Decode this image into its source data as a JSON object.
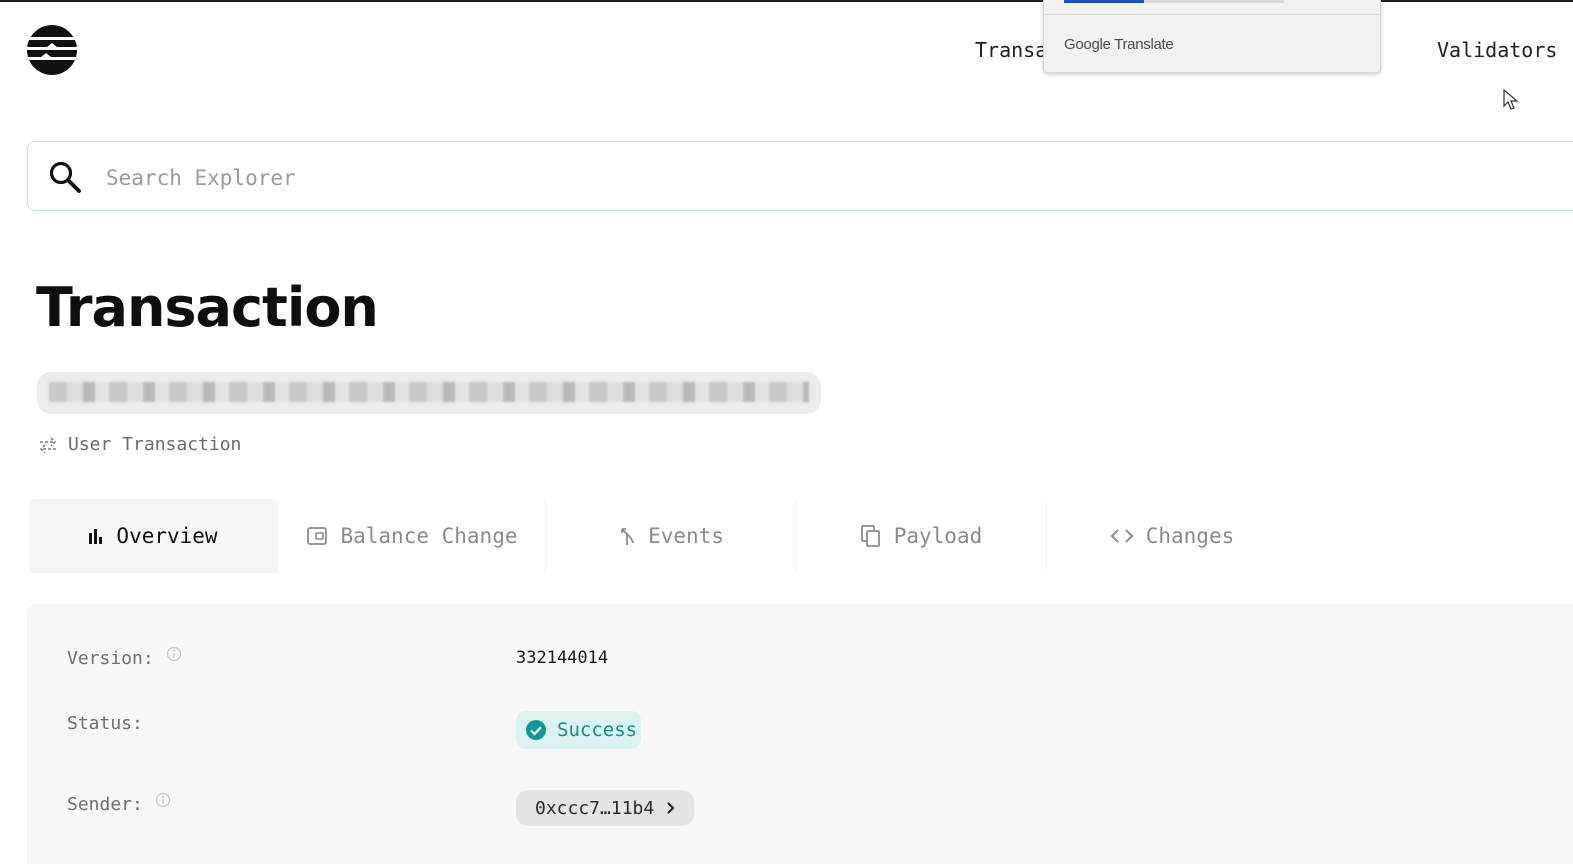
{
  "nav": {
    "transactions_label": "Transa",
    "validators_label": "Validators"
  },
  "translate_popup": {
    "brand": "Google Translate"
  },
  "search": {
    "placeholder": "Search Explorer",
    "value": ""
  },
  "page": {
    "title": "Transaction",
    "hash_blurred": true,
    "tx_type": "User Transaction"
  },
  "tabs": [
    {
      "label": "Overview",
      "icon": "bar-chart-icon",
      "active": true
    },
    {
      "label": "Balance Change",
      "icon": "wallet-icon",
      "active": false
    },
    {
      "label": "Events",
      "icon": "merge-arrow-icon",
      "active": false
    },
    {
      "label": "Payload",
      "icon": "copy-pages-icon",
      "active": false
    },
    {
      "label": "Changes",
      "icon": "code-brackets-icon",
      "active": false
    }
  ],
  "overview": {
    "version_label": "Version:",
    "version_value": "332144014",
    "status_label": "Status:",
    "status_value": "Success",
    "sender_label": "Sender:",
    "sender_value": "0xccc7…11b4"
  },
  "colors": {
    "accent": "#0f8f8c",
    "status_bg": "#dcf2f2",
    "search_border": "#bfe6e6"
  }
}
